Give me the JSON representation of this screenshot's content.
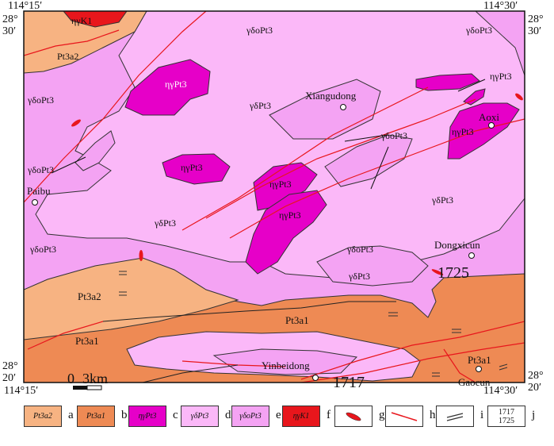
{
  "corner_coords": {
    "top_left_lon": "114°15′",
    "top_right_lon": "114°30′",
    "bottom_left_lon": "114°15′",
    "bottom_right_lon": "114°30′",
    "top_left_lat_deg": "28°",
    "top_left_lat_min": "30′",
    "top_right_lat_deg": "28°",
    "top_right_lat_min": "30′",
    "bottom_left_lat_deg": "28°",
    "bottom_left_lat_min": "20′",
    "bottom_right_lat_deg": "28°",
    "bottom_right_lat_min": "20′"
  },
  "colors": {
    "pt3a2": "#f7b382",
    "pt3a1": "#ee8a54",
    "gdpt3": "#fbb8f8",
    "godpt3": "#f4a3f3",
    "ngpt3": "#e600c8",
    "ngk1": "#e8161c",
    "fault": "#e8161c"
  },
  "map_labels": {
    "ngk1": "ηγK1",
    "pt3a2_top": "Pt3a2",
    "pt3a2_bottom": "Pt3a2",
    "pt3a1_mid": "Pt3a1",
    "pt3a1_left": "Pt3a1",
    "pt3a1_right": "Pt3a1",
    "ngpt3_1": "ηγPt3",
    "ngpt3_2": "ηγPt3",
    "ngpt3_3": "ηγPt3",
    "ngpt3_4": "ηγPt3",
    "ngpt3_5": "ηγPt3",
    "ngpt3_6": "ηγPt3",
    "gdpt3_top": "γδPt3",
    "gdpt3_mid": "γδPt3",
    "gdpt3_left": "γδPt3",
    "gdpt3_right": "γδPt3",
    "gdpt3_low": "γδPt3",
    "godpt3_1": "γδoPt3",
    "godpt3_2": "γδoPt3",
    "godpt3_3": "γδoPt3",
    "godpt3_4": "γδoPt3",
    "godpt3_5": "γδoPt3",
    "godpt3_6": "γδoPt3",
    "godpt3_7": "γδoPt3"
  },
  "places": {
    "xiangudong": "Xiangudong",
    "aoxi": "Aoxi",
    "paibu": "Paibu",
    "dongxicun": "Dongxicun",
    "yinbeidong": "Yinbeidong",
    "gaocun": "Gaocun"
  },
  "samples": {
    "s1725": "1725",
    "s1717": "1717"
  },
  "scale_bar": {
    "label_zero": "0",
    "label_km": "3km"
  },
  "legend": [
    {
      "key": "pt3a2",
      "text": "Pt3a2",
      "letter": "a"
    },
    {
      "key": "pt3a1",
      "text": "Pt3a1",
      "letter": "b"
    },
    {
      "key": "ngpt3",
      "text": "ηγPt3",
      "letter": "c"
    },
    {
      "key": "gdpt3",
      "text": "γδPt3",
      "letter": "d"
    },
    {
      "key": "godpt3",
      "text": "γδoPt3",
      "letter": "e"
    },
    {
      "key": "ngk1",
      "text": "ηγK1",
      "letter": "f"
    },
    {
      "key": "lens",
      "text": "",
      "letter": "g"
    },
    {
      "key": "fault",
      "text": "",
      "letter": "h"
    },
    {
      "key": "attitude",
      "text": "",
      "letter": "i"
    },
    {
      "key": "sample",
      "text_top": "1717",
      "text_bottom": "1725",
      "letter": "j"
    }
  ]
}
